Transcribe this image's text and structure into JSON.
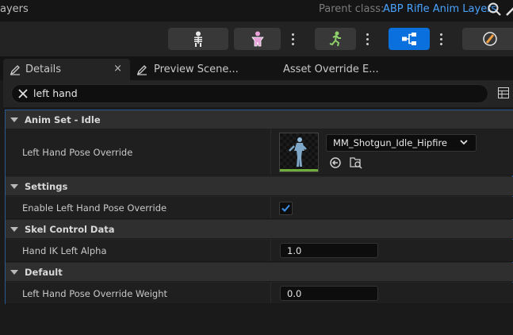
{
  "titlebar": {
    "title": "ayers",
    "parent_class_label": "Parent class:",
    "parent_class_value": "ABP Rifle Anim Layers",
    "search_icon": "search-icon",
    "edit_icon": "edit-icon"
  },
  "toolbar": {
    "buttons": [
      {
        "icon": "skeleton-icon"
      },
      {
        "icon": "skeletal-mesh-icon"
      },
      {
        "icon": "running-man-icon"
      },
      {
        "icon": "blueprint-graph-icon",
        "active": true
      },
      {
        "icon": "brush-icon"
      }
    ]
  },
  "tabs": [
    {
      "label": "Details",
      "close": "×"
    },
    {
      "label": "Preview Scene..."
    },
    {
      "label": "Asset Override E..."
    }
  ],
  "search": {
    "value": "left hand",
    "clear_icon": "close-icon"
  },
  "categories": {
    "anim_set": "Anim Set - Idle",
    "settings": "Settings",
    "skel_control": "Skel Control Data",
    "default": "Default"
  },
  "properties": {
    "left_hand_pose_override": {
      "label": "Left Hand Pose Override",
      "asset": "MM_Shotgun_Idle_Hipfire"
    },
    "enable_left_hand_pose_override": {
      "label": "Enable Left Hand Pose Override",
      "checked": true
    },
    "hand_ik_left_alpha": {
      "label": "Hand IK Left Alpha",
      "value": "1.0"
    },
    "left_hand_pose_override_weight": {
      "label": "Left Hand Pose Override Weight",
      "value": "0.0"
    }
  },
  "colors": {
    "accent": "#0a70de",
    "link": "#4aa3ff",
    "panel_border": "#2a5a93"
  }
}
